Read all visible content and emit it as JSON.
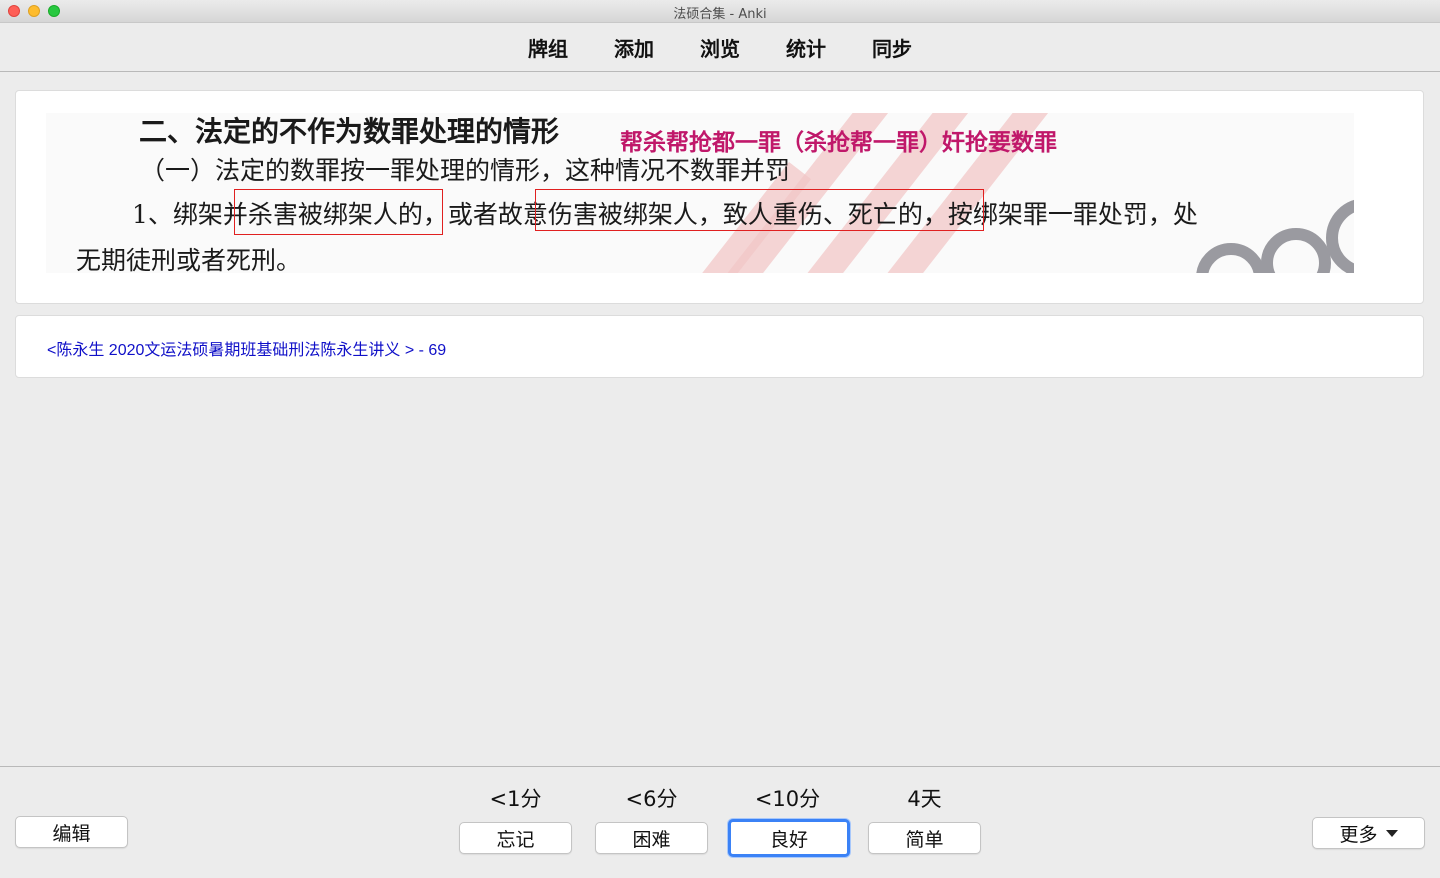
{
  "window": {
    "title": "法硕合集 - Anki"
  },
  "toolbar": {
    "items": [
      "牌组",
      "添加",
      "浏览",
      "统计",
      "同步"
    ]
  },
  "card": {
    "image": {
      "heading": "二、法定的不作为数罪处理的情形",
      "mnemonic": "帮杀帮抢都一罪（杀抢帮一罪）奸抢要数罪",
      "subheading": "（一）法定的数罪按一罪处理的情形，这种情况不数罪并罚",
      "line1": "1、绑架并杀害被绑架人的，或者故意伤害被绑架人，致人重伤、死亡的，按绑架罪一罪处罚，处",
      "line2": "无期徒刑或者死刑。"
    },
    "source": "<陈永生 2020文运法硕暑期班基础刑法陈永生讲义 > - 69"
  },
  "bottom": {
    "edit_label": "编辑",
    "more_label": "更多",
    "answers": [
      {
        "interval": "<1分",
        "label": "忘记"
      },
      {
        "interval": "<6分",
        "label": "困难"
      },
      {
        "interval": "<10分",
        "label": "良好",
        "default": true
      },
      {
        "interval": "4天",
        "label": "简单"
      }
    ]
  },
  "colors": {
    "accent": "#3b82f6",
    "mnemonic": "#c0186a",
    "highlight_box": "#e02020",
    "link": "#1010c8"
  }
}
